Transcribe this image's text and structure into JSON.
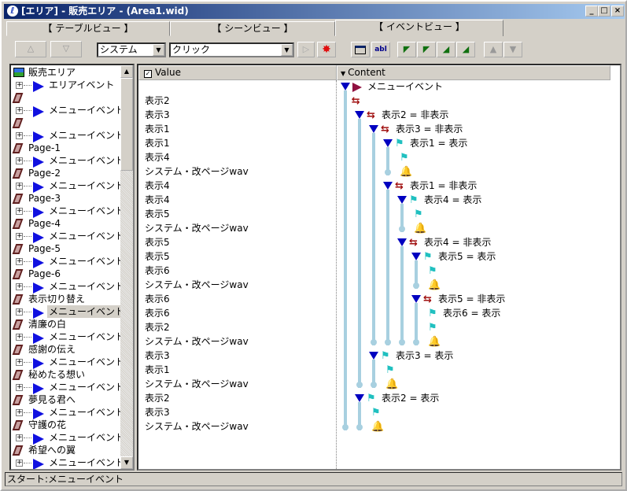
{
  "window": {
    "title": "[エリア] - 販売エリア - (Area1.wid)",
    "controls": [
      "_",
      "□",
      "×"
    ]
  },
  "tabs": [
    {
      "label": "【 テーブルビュー 】"
    },
    {
      "label": "【 シーンビュー 】"
    },
    {
      "label": "【 イベントビュー 】",
      "active": true
    }
  ],
  "toolbar": {
    "up_label": "△",
    "down_label": "▽",
    "category_select": "システム",
    "action_select": "クリック",
    "play_label": "▷",
    "icons": [
      "play-icon",
      "delete-star-icon",
      "window-icon",
      "text-field-icon",
      "indent-all-icon",
      "indent-icon",
      "outdent-icon",
      "outdent-all-icon",
      "move-up-icon",
      "move-down-icon"
    ]
  },
  "sidebar": {
    "items": [
      {
        "type": "area",
        "label": "販売エリア"
      },
      {
        "type": "event",
        "label": "エリアイベント"
      },
      {
        "type": "page",
        "label": ""
      },
      {
        "type": "event",
        "label": "メニューイベント"
      },
      {
        "type": "page",
        "label": ""
      },
      {
        "type": "event",
        "label": "メニューイベント"
      },
      {
        "type": "page",
        "label": "Page-1"
      },
      {
        "type": "event",
        "label": "メニューイベント"
      },
      {
        "type": "page",
        "label": "Page-2"
      },
      {
        "type": "event",
        "label": "メニューイベント"
      },
      {
        "type": "page",
        "label": "Page-3"
      },
      {
        "type": "event",
        "label": "メニューイベント"
      },
      {
        "type": "page",
        "label": "Page-4"
      },
      {
        "type": "event",
        "label": "メニューイベント"
      },
      {
        "type": "page",
        "label": "Page-5"
      },
      {
        "type": "event",
        "label": "メニューイベント"
      },
      {
        "type": "page",
        "label": "Page-6"
      },
      {
        "type": "event",
        "label": "メニューイベント"
      },
      {
        "type": "page",
        "label": "表示切り替え"
      },
      {
        "type": "event",
        "label": "メニューイベント",
        "selected": true
      },
      {
        "type": "page",
        "label": "清廉の白"
      },
      {
        "type": "event",
        "label": "メニューイベント"
      },
      {
        "type": "page",
        "label": "感謝の伝え"
      },
      {
        "type": "event",
        "label": "メニューイベント"
      },
      {
        "type": "page",
        "label": "秘めたる想い"
      },
      {
        "type": "event",
        "label": "メニューイベント"
      },
      {
        "type": "page",
        "label": "夢見る君へ"
      },
      {
        "type": "event",
        "label": "メニューイベント"
      },
      {
        "type": "page",
        "label": "守護の花"
      },
      {
        "type": "event",
        "label": "メニューイベント"
      },
      {
        "type": "page",
        "label": "希望への翼"
      },
      {
        "type": "event",
        "label": "メニューイベント"
      }
    ]
  },
  "grid": {
    "value_header": "Value",
    "content_header": "Content",
    "rows": [
      {
        "value": "",
        "depth": 1,
        "toggle": true,
        "icon": "event",
        "text": "メニューイベント"
      },
      {
        "value": "表示2",
        "depth": 0.6,
        "icon": "branch",
        "text": ""
      },
      {
        "value": "表示3",
        "depth": 2,
        "toggle": true,
        "icon": "branch",
        "text": "表示2 = 非表示"
      },
      {
        "value": "表示1",
        "depth": 3,
        "toggle": true,
        "icon": "branch",
        "text": "表示3 = 非表示"
      },
      {
        "value": "表示1",
        "depth": 4,
        "toggle": true,
        "icon": "flag",
        "text": "表示1 = 表示"
      },
      {
        "value": "表示4",
        "depth": 4,
        "icon": "flag",
        "text": ""
      },
      {
        "value": "システム・改ページwav",
        "depth": 4,
        "icon": "sound",
        "text": ""
      },
      {
        "value": "表示4",
        "depth": 4,
        "toggle": true,
        "icon": "branch",
        "text": "表示1 = 非表示"
      },
      {
        "value": "表示4",
        "depth": 5,
        "toggle": true,
        "icon": "flag",
        "text": "表示4 = 表示"
      },
      {
        "value": "表示5",
        "depth": 5,
        "icon": "flag",
        "text": ""
      },
      {
        "value": "システム・改ページwav",
        "depth": 5,
        "icon": "sound",
        "text": ""
      },
      {
        "value": "表示5",
        "depth": 5,
        "toggle": true,
        "icon": "branch",
        "text": "表示4 = 非表示"
      },
      {
        "value": "表示5",
        "depth": 6,
        "toggle": true,
        "icon": "flag",
        "text": "表示5 = 表示"
      },
      {
        "value": "表示6",
        "depth": 6,
        "icon": "flag",
        "text": ""
      },
      {
        "value": "システム・改ページwav",
        "depth": 6,
        "icon": "sound",
        "text": ""
      },
      {
        "value": "表示6",
        "depth": 6,
        "toggle": true,
        "icon": "branch",
        "text": "表示5 = 非表示"
      },
      {
        "value": "表示6",
        "depth": 6,
        "icon": "flag",
        "text": "表示6 = 表示"
      },
      {
        "value": "表示2",
        "depth": 6,
        "icon": "flag",
        "text": ""
      },
      {
        "value": "システム・改ページwav",
        "depth": 6,
        "icon": "sound",
        "text": ""
      },
      {
        "value": "表示3",
        "depth": 3,
        "toggle": true,
        "icon": "flag",
        "text": "表示3 = 表示"
      },
      {
        "value": "表示1",
        "depth": 3,
        "icon": "flag",
        "text": ""
      },
      {
        "value": "システム・改ページwav",
        "depth": 3,
        "icon": "sound",
        "text": ""
      },
      {
        "value": "表示2",
        "depth": 2,
        "toggle": true,
        "icon": "flag",
        "text": "表示2 = 表示"
      },
      {
        "value": "表示3",
        "depth": 2,
        "icon": "flag",
        "text": ""
      },
      {
        "value": "システム・改ページwav",
        "depth": 2,
        "icon": "sound",
        "text": ""
      }
    ]
  },
  "status": {
    "text": "スタート:メニューイベント"
  }
}
